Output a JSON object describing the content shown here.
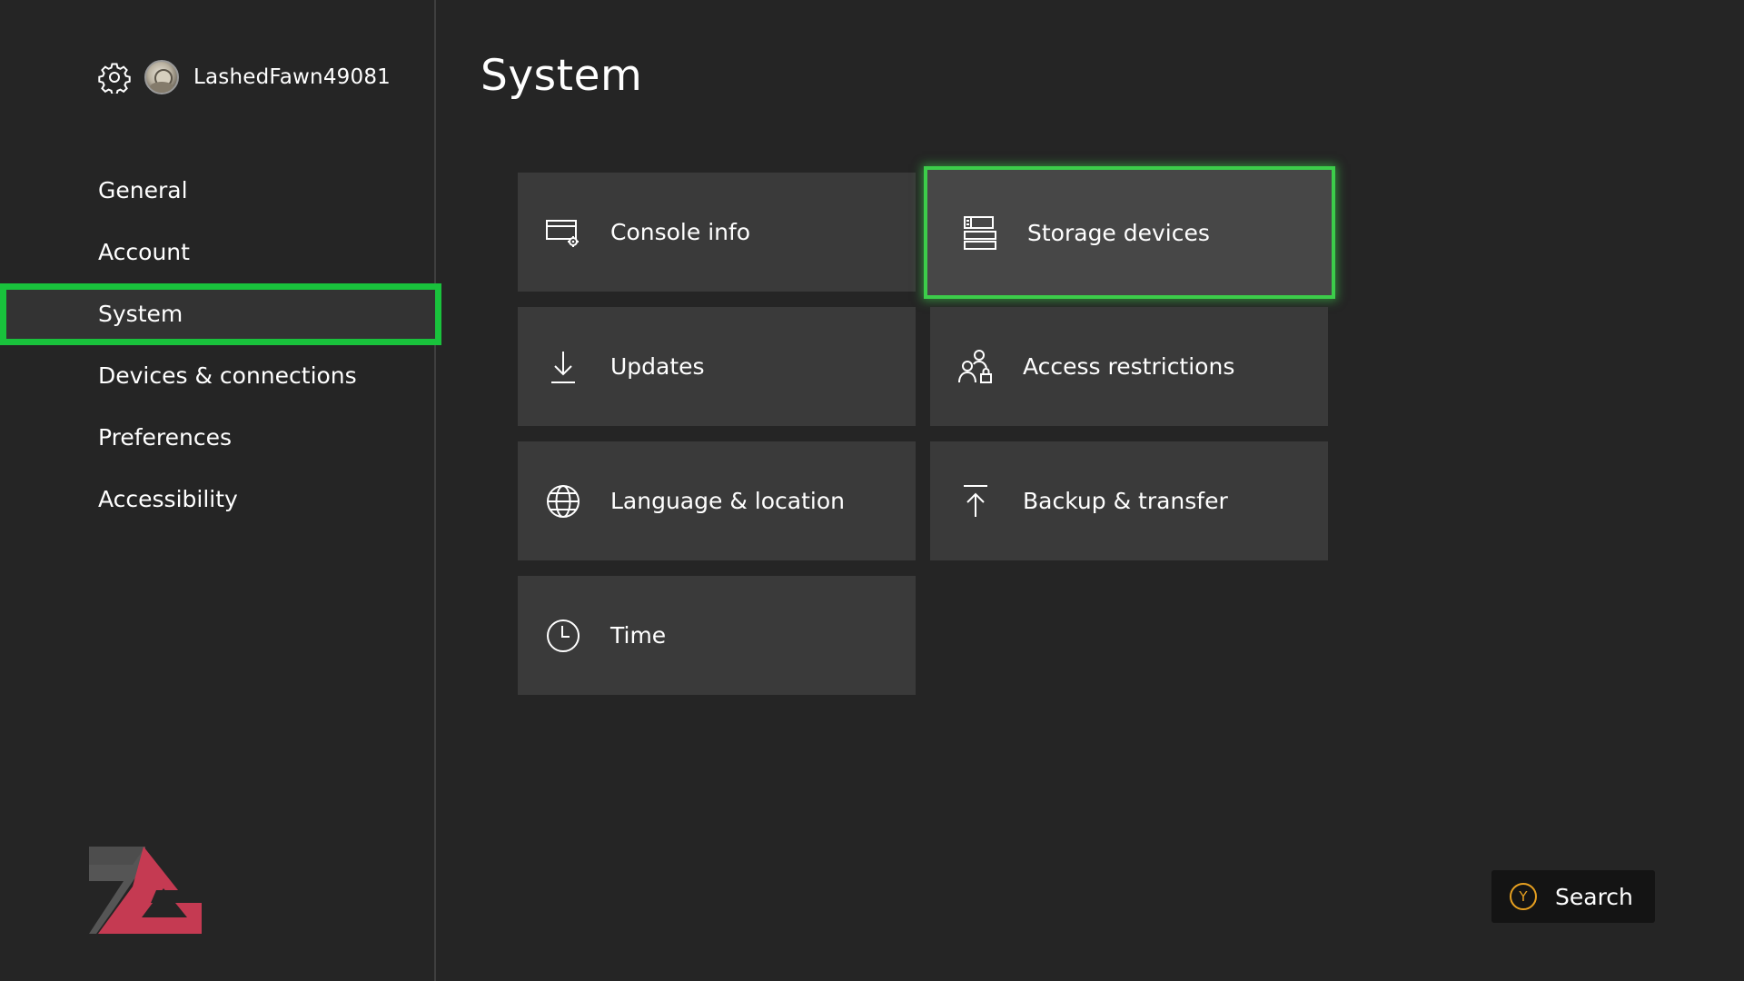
{
  "profile": {
    "username": "LashedFawn49081",
    "icons": [
      "gear-icon",
      "avatar"
    ]
  },
  "sidebar": {
    "items": [
      {
        "label": "General"
      },
      {
        "label": "Account"
      },
      {
        "label": "System",
        "selected": true
      },
      {
        "label": "Devices & connections"
      },
      {
        "label": "Preferences"
      },
      {
        "label": "Accessibility"
      }
    ]
  },
  "main": {
    "title": "System",
    "tiles": [
      {
        "label": "Console info",
        "icon": "console-info-icon"
      },
      {
        "label": "Storage devices",
        "icon": "storage-icon",
        "focused": true
      },
      {
        "label": "Updates",
        "icon": "download-icon"
      },
      {
        "label": "Access restrictions",
        "icon": "people-lock-icon"
      },
      {
        "label": "Language & location",
        "icon": "globe-icon"
      },
      {
        "label": "Backup & transfer",
        "icon": "upload-icon"
      },
      {
        "label": "Time",
        "icon": "clock-icon"
      }
    ]
  },
  "footer": {
    "search_button_glyph": "Y",
    "search_label": "Search"
  },
  "colors": {
    "background": "#252525",
    "tile": "#3a3a3a",
    "focus_green": "#3ccd4a",
    "selected_outline": "#19c23c",
    "y_button": "#e7a020"
  }
}
